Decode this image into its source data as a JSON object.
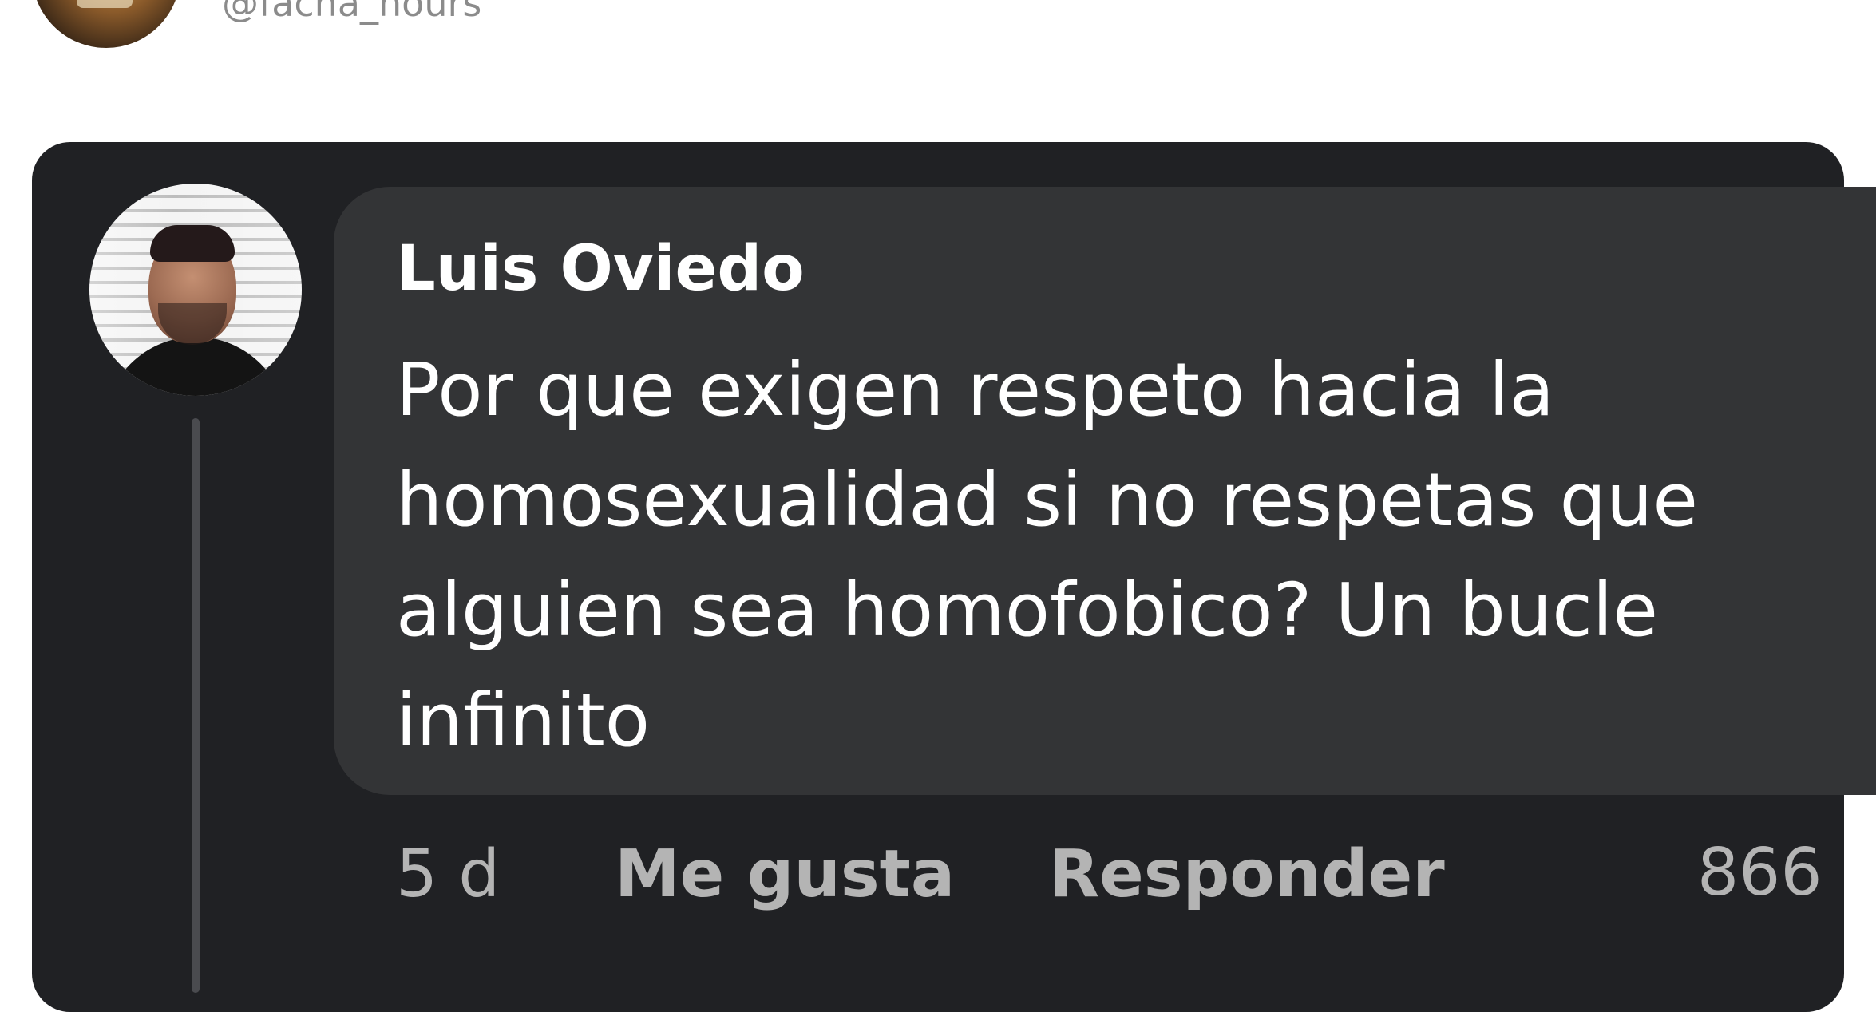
{
  "post": {
    "handle": "@facha_hours"
  },
  "comment": {
    "author": "Luis Oviedo",
    "text_lines": [
      "Por que exigen respeto hacia la",
      "homosexualidad si no respetas que",
      "alguien sea homofobico? Un bucle",
      "infinito"
    ],
    "time": "5 d",
    "like_label": "Me gusta",
    "reply_label": "Responder",
    "likes_count": "866"
  },
  "colors": {
    "card_background": "#202124",
    "bubble_background": "#333436",
    "primary_text": "#ffffff",
    "secondary_text": "#b4b4b4",
    "handle_text": "#8b8b8b"
  }
}
